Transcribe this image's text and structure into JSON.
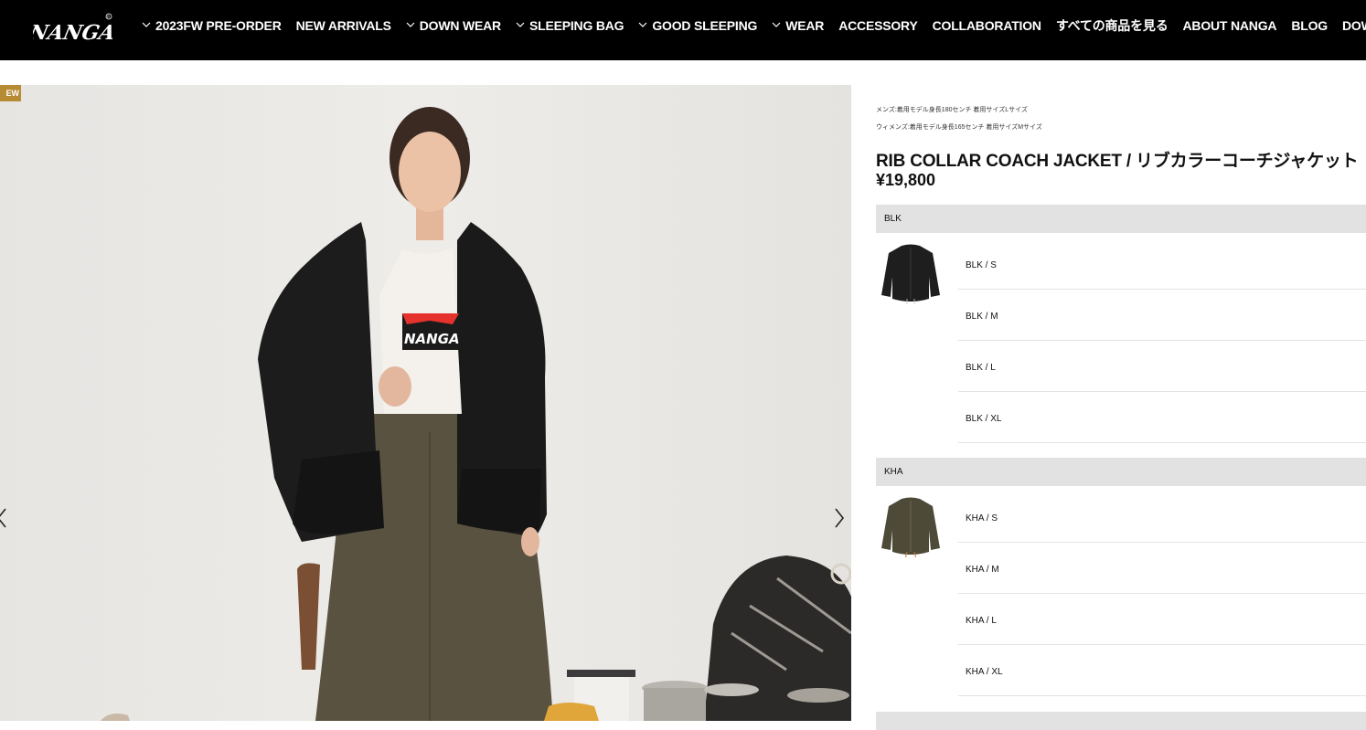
{
  "brand": {
    "logo_text": "NANGA"
  },
  "nav": [
    {
      "label": "2023FW PRE-ORDER",
      "dropdown": true
    },
    {
      "label": "NEW ARRIVALS",
      "dropdown": false
    },
    {
      "label": "DOWN WEAR",
      "dropdown": true
    },
    {
      "label": "SLEEPING BAG",
      "dropdown": true
    },
    {
      "label": "GOOD SLEEPING",
      "dropdown": true
    },
    {
      "label": "WEAR",
      "dropdown": true
    },
    {
      "label": "ACCESSORY",
      "dropdown": false
    },
    {
      "label": "COLLABORATION",
      "dropdown": false
    },
    {
      "label": "すべての商品を見る",
      "dropdown": false
    },
    {
      "label": "ABOUT NANGA",
      "dropdown": false
    },
    {
      "label": "BLOG",
      "dropdown": false
    },
    {
      "label": "DOWN WEAR R",
      "dropdown": false
    }
  ],
  "gallery": {
    "badge": "EW",
    "tee_print": "NANGA"
  },
  "product": {
    "model_note_mens": "メンズ:着用モデル身長180センチ 着用サイズLサイズ",
    "model_note_womens": "ウィメンズ:着用モデル身長165センチ 着用サイズMサイズ",
    "title": "RIB COLLAR COACH JACKET / リブカラーコーチジャケット",
    "price": "¥19,800"
  },
  "colors": [
    {
      "code": "BLK",
      "swatch": "#1e1e1e",
      "sizes": [
        "BLK / S",
        "BLK / M",
        "BLK / L",
        "BLK / XL"
      ]
    },
    {
      "code": "KHA",
      "swatch": "#4d4a38",
      "sizes": [
        "KHA / S",
        "KHA / M",
        "KHA / L",
        "KHA / XL"
      ]
    }
  ],
  "theme": {
    "header_bg": "#000000",
    "badge": "#b78a34",
    "group_bg": "#e2e2e2"
  }
}
